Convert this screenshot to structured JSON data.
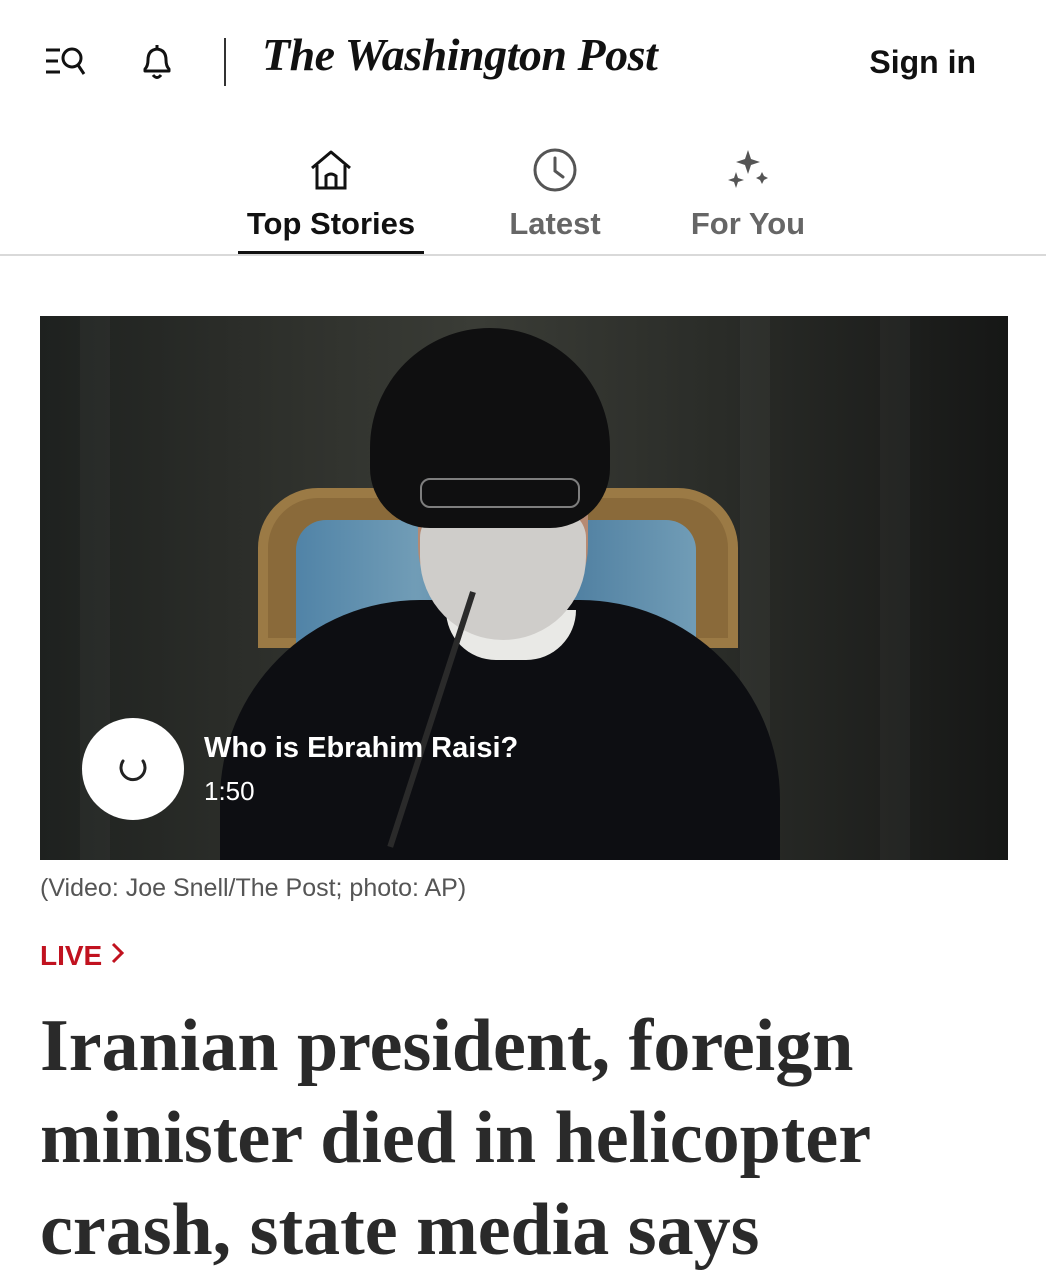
{
  "header": {
    "masthead": "The Washington Post",
    "signin_label": "Sign in",
    "icons": [
      "menu-search-icon",
      "bell-icon"
    ]
  },
  "tabs": [
    {
      "label": "Top Stories",
      "icon": "home-icon",
      "active": true
    },
    {
      "label": "Latest",
      "icon": "clock-icon",
      "active": false
    },
    {
      "label": "For You",
      "icon": "sparkle-icon",
      "active": false
    }
  ],
  "video": {
    "title": "Who is Ebrahim Raisi?",
    "duration": "1:50",
    "caption": "(Video: Joe Snell/The Post; photo: AP)"
  },
  "article": {
    "live_label": "LIVE",
    "headline": "Iranian president, foreign minister died in helicopter crash, state media says"
  },
  "colors": {
    "live_red": "#c1121f",
    "text_dark": "#111111",
    "tab_inactive": "#666666"
  }
}
